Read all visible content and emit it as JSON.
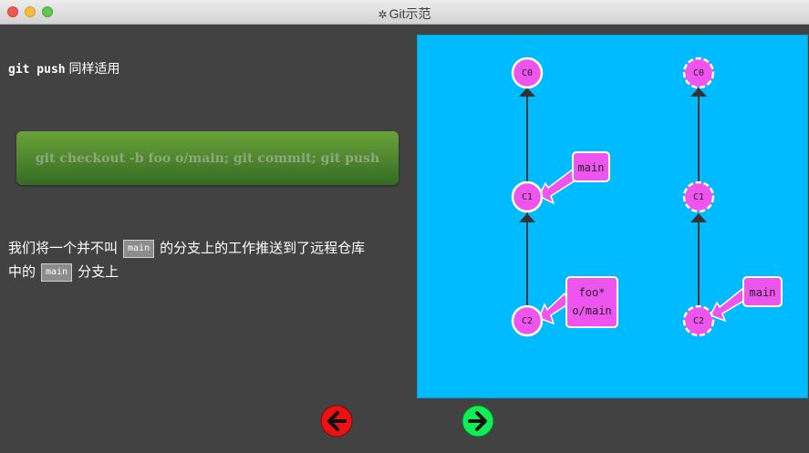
{
  "window": {
    "title": "Git示范",
    "title_icon": "gear-icon"
  },
  "lesson": {
    "intro_command": "git push",
    "intro_text": "同样适用",
    "command_box": "git checkout -b foo o/main; git commit; git push",
    "para_part1": "我们将一个并不叫",
    "para_code1": "main",
    "para_part2": "的分支上的工作推送到了远程仓库",
    "para_part3": "中的",
    "para_code2": "main",
    "para_part4": "分支上"
  },
  "visualization": {
    "local_repo": {
      "commits": [
        "C0",
        "C1",
        "C2"
      ],
      "branch_main": "main",
      "branch_foo": "foo*",
      "branch_origin_main": "o/main"
    },
    "remote_repo": {
      "commits": [
        "C0",
        "C1",
        "C2"
      ],
      "branch_main": "main"
    },
    "colors": {
      "background": "#00bbff",
      "commit": "#ee55ee",
      "edge": "#333333"
    }
  },
  "navigation": {
    "back_icon": "back-arrow-icon",
    "forward_icon": "forward-arrow-icon",
    "back_color": "#ee1111",
    "forward_color": "#11ee55"
  }
}
